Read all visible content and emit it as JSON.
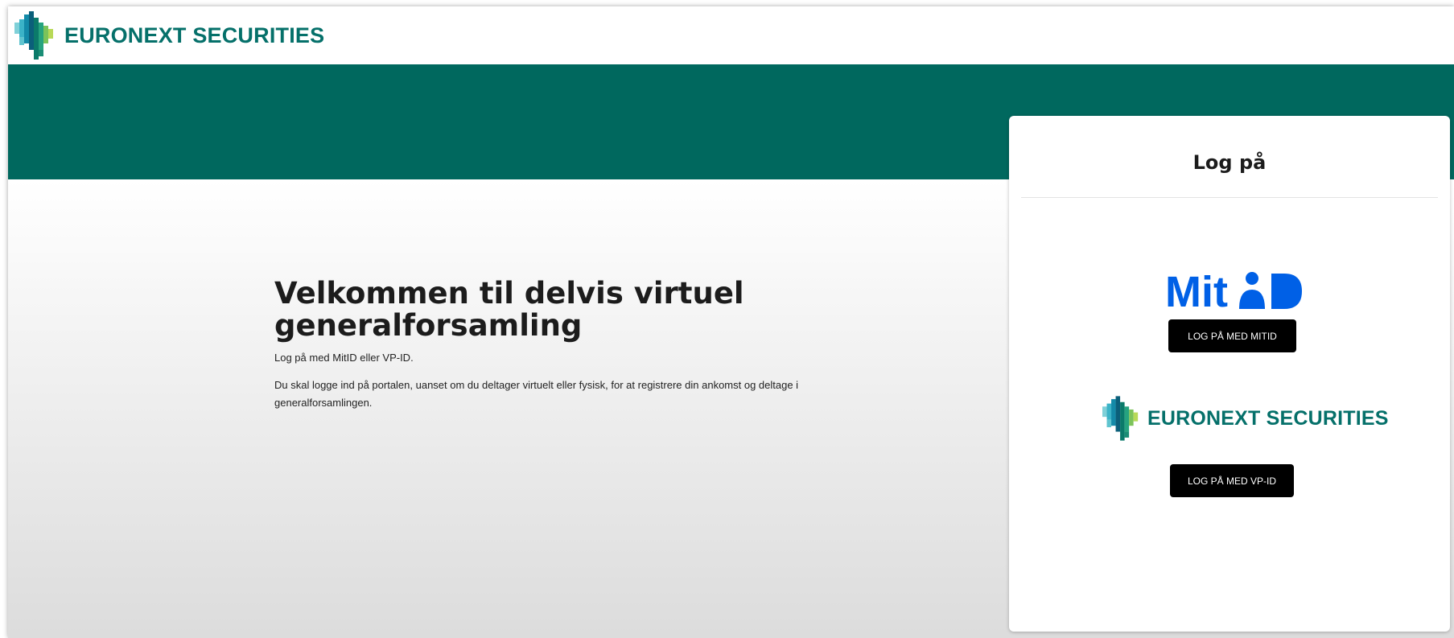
{
  "header": {
    "logo_text": "EURONEXT SECURITIES",
    "logo_icon": "euronext-pixel-logo"
  },
  "main": {
    "title": "Velkommen til delvis virtuel generalforsamling",
    "subtitle": "Log på med MitID eller VP-ID.",
    "description": "Du skal logge ind på portalen, uanset om du deltager virtuelt eller fysisk, for at registrere din ankomst og deltage i generalforsamlingen."
  },
  "login_card": {
    "title": "Log på",
    "mitid_logo_text": "MitID",
    "mitid_button": "LOG PÅ MED MITID",
    "euronext_logo_text": "EURONEXT SECURITIES",
    "vpid_button": "LOG PÅ MED VP-ID"
  },
  "colors": {
    "brand_green": "#00685e",
    "logo_text": "#05706a",
    "mitid_blue": "#0060e6",
    "button_bg": "#000000"
  }
}
